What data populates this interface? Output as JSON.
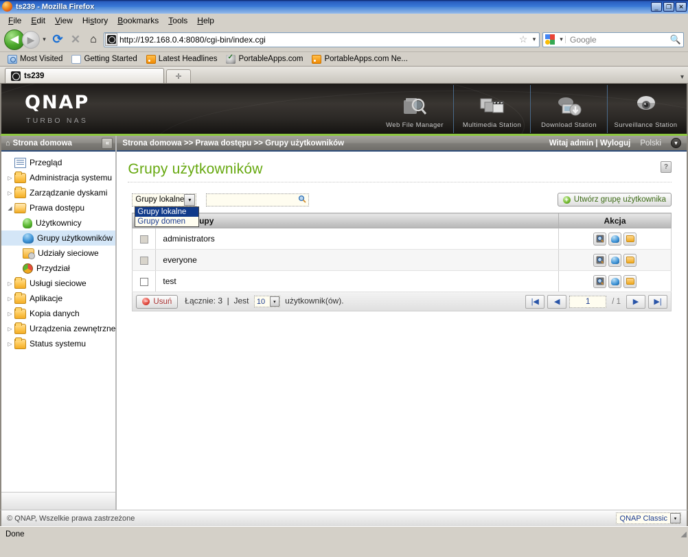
{
  "browser": {
    "window_title": "ts239 - Mozilla Firefox",
    "window_icon": "firefox-logo-icon",
    "minimize_label": "_",
    "maximize_label": "❐",
    "close_label": "✕",
    "menu": [
      "File",
      "Edit",
      "View",
      "History",
      "Bookmarks",
      "Tools",
      "Help"
    ],
    "nav": {
      "back_label": "◀",
      "forward_label": "▶",
      "dropdown_label": "▾",
      "reload_label": "⟳",
      "stop_label": "✕",
      "home_label": "⌂",
      "url": "http://192.168.0.4:8080/cgi-bin/index.cgi",
      "star_label": "☆",
      "url_caret": "▾",
      "search_engine": "Google",
      "search_placeholder": "Google",
      "search_caret": "▾",
      "search_mag": "🔍"
    },
    "bookmarks": [
      {
        "label": "Most Visited",
        "icon": "most-visited-icon"
      },
      {
        "label": "Getting Started",
        "icon": "document-icon"
      },
      {
        "label": "Latest Headlines",
        "icon": "rss-feed-icon"
      },
      {
        "label": "PortableApps.com",
        "icon": "portableapps-icon"
      },
      {
        "label": "PortableApps.com Ne...",
        "icon": "rss-feed-icon"
      }
    ],
    "tabs": [
      {
        "label": "ts239",
        "icon": "qnap-favicon"
      }
    ],
    "new_tab_label": "✛",
    "list_all_tabs_label": "▾",
    "status_text": "Done"
  },
  "banner": {
    "brand": "QNAP",
    "tagline": "TURBO NAS",
    "stations": [
      {
        "label": "Web File Manager",
        "icon": "web-file-manager-icon"
      },
      {
        "label": "Multimedia Station",
        "icon": "multimedia-station-icon"
      },
      {
        "label": "Download Station",
        "icon": "download-station-icon"
      },
      {
        "label": "Surveillance Station",
        "icon": "surveillance-station-icon"
      }
    ]
  },
  "sidebar": {
    "header": "Strona domowa",
    "header_icon": "home-icon",
    "collapse_label": "«",
    "items": [
      {
        "label": "Przegląd",
        "icon": "overview-doc-icon",
        "arrow": "",
        "indent": 1,
        "selected": false
      },
      {
        "label": "Administracja systemu",
        "icon": "folder-icon",
        "arrow": "▷",
        "indent": 0,
        "selected": false
      },
      {
        "label": "Zarządzanie dyskami",
        "icon": "folder-icon",
        "arrow": "▷",
        "indent": 0,
        "selected": false
      },
      {
        "label": "Prawa dostępu",
        "icon": "folder-open-icon",
        "arrow": "◢",
        "indent": 0,
        "selected": false
      },
      {
        "label": "Użytkownicy",
        "icon": "user-green-icon",
        "arrow": "",
        "indent": 2,
        "selected": false
      },
      {
        "label": "Grupy użytkowników",
        "icon": "users-blue-icon",
        "arrow": "",
        "indent": 2,
        "selected": true
      },
      {
        "label": "Udziały sieciowe",
        "icon": "share-folder-icon",
        "arrow": "",
        "indent": 2,
        "selected": false
      },
      {
        "label": "Przydział",
        "icon": "quota-pie-icon",
        "arrow": "",
        "indent": 2,
        "selected": false
      },
      {
        "label": "Usługi sieciowe",
        "icon": "folder-icon",
        "arrow": "▷",
        "indent": 0,
        "selected": false
      },
      {
        "label": "Aplikacje",
        "icon": "folder-icon",
        "arrow": "▷",
        "indent": 0,
        "selected": false
      },
      {
        "label": "Kopia danych",
        "icon": "folder-icon",
        "arrow": "▷",
        "indent": 0,
        "selected": false
      },
      {
        "label": "Urządzenia zewnętrzne",
        "icon": "folder-icon",
        "arrow": "▷",
        "indent": 0,
        "selected": false
      },
      {
        "label": "Status systemu",
        "icon": "folder-icon",
        "arrow": "▷",
        "indent": 0,
        "selected": false
      }
    ]
  },
  "content": {
    "breadcrumb": "Strona domowa >> Prawa dostępu >> Grupy użytkowników",
    "greeting": "Witaj admin | Wyloguj",
    "language": "Polski",
    "language_caret": "▾",
    "page_title": "Grupy użytkowników",
    "help_label": "?",
    "toolbar": {
      "group_filter_value": "Grupy lokalne",
      "group_filter_caret": "▾",
      "group_filter_options": [
        "Grupy lokalne",
        "Grupy domen"
      ],
      "group_filter_selected_index": 0,
      "search_value": "",
      "search_placeholder": "",
      "search_icon": "search-magnifier-icon",
      "create_button": "Utwórz grupę użytkownika",
      "create_icon": "plus-circle-icon"
    },
    "table": {
      "columns": [
        "",
        "Nazwa grupy",
        "Akcja"
      ],
      "rows": [
        {
          "name": "administrators",
          "checked": false,
          "checkbox_disabled": true
        },
        {
          "name": "everyone",
          "checked": false,
          "checkbox_disabled": true
        },
        {
          "name": "test",
          "checked": false,
          "checkbox_disabled": false
        }
      ],
      "action_icons": [
        "view-details-icon",
        "edit-members-icon",
        "edit-share-folder-icon"
      ]
    },
    "footer": {
      "delete_button": "Usuń",
      "delete_icon": "minus-circle-icon",
      "total_label": "Łącznie:",
      "total_value": "3",
      "separator": "|",
      "show_label": "Jest",
      "page_size": "10",
      "page_size_caret": "▾",
      "unit_label": "użytkownik(ów).",
      "pager": {
        "first_label": "|◀",
        "prev_label": "◀",
        "current_page": "1",
        "of_label": "/ 1",
        "next_label": "▶",
        "last_label": "▶|"
      }
    },
    "page_footer": {
      "copyright": "© QNAP, Wszelkie prawa zastrzeżone",
      "skin": "QNAP Classic",
      "skin_caret": "▾"
    }
  },
  "colors": {
    "accent_green": "#66a80f",
    "banner_green": "#8cc63f",
    "titlebar_blue": "#3a7ad8",
    "selection_blue": "#d4e6f7",
    "dropdown_highlight": "#103a8a",
    "chrome_gray": "#d4d0c8"
  }
}
